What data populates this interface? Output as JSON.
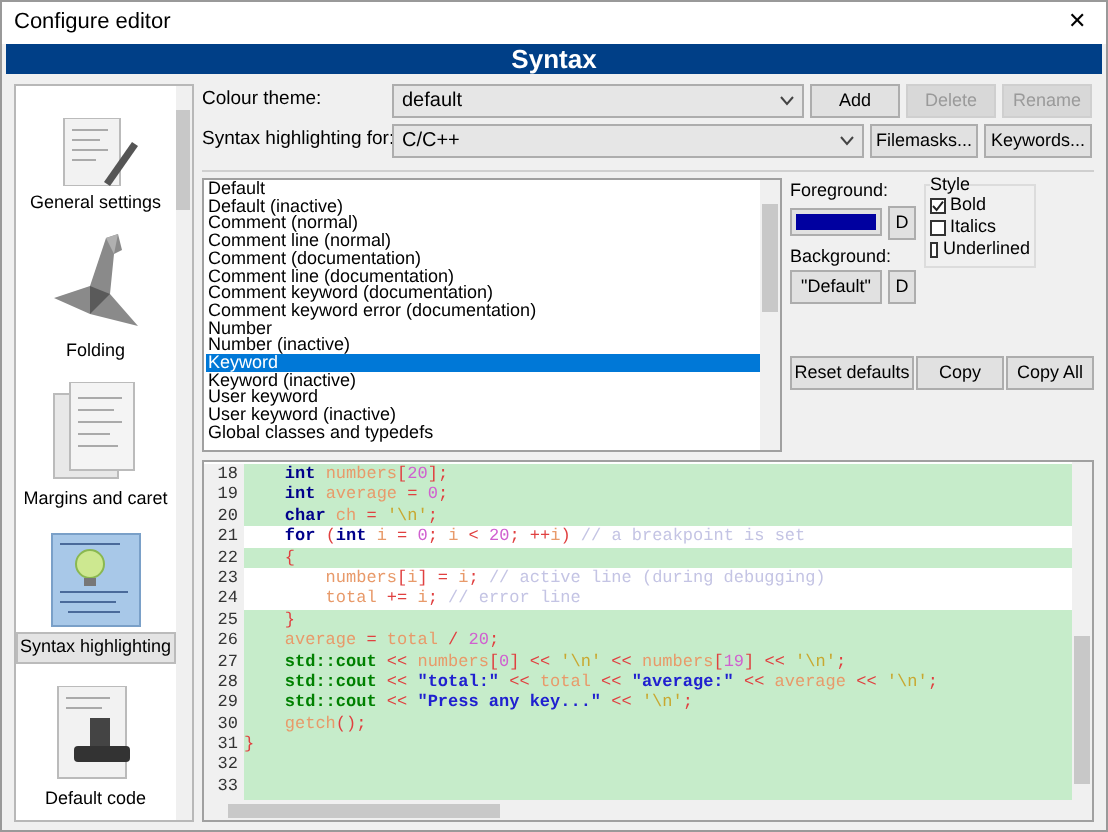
{
  "window": {
    "title": "Configure editor",
    "close": "✕"
  },
  "header": "Syntax",
  "sidebar": {
    "items": [
      {
        "label": "General settings",
        "selected": false
      },
      {
        "label": "Folding",
        "selected": false
      },
      {
        "label": "Margins and caret",
        "selected": false
      },
      {
        "label": "Syntax highlighting",
        "selected": true
      },
      {
        "label": "Default code",
        "selected": false
      }
    ]
  },
  "theme": {
    "label": "Colour theme:",
    "value": "default",
    "buttons": [
      {
        "label": "Add",
        "disabled": false
      },
      {
        "label": "Delete",
        "disabled": true
      },
      {
        "label": "Rename",
        "disabled": true
      }
    ]
  },
  "language": {
    "label": "Syntax highlighting for:",
    "value": "C/C++",
    "buttons": [
      {
        "label": "Filemasks...",
        "disabled": false
      },
      {
        "label": "Keywords...",
        "disabled": false
      }
    ]
  },
  "styles": [
    {
      "label": "Default",
      "selected": false
    },
    {
      "label": "Default (inactive)",
      "selected": false
    },
    {
      "label": "Comment (normal)",
      "selected": false
    },
    {
      "label": "Comment line (normal)",
      "selected": false
    },
    {
      "label": "Comment (documentation)",
      "selected": false
    },
    {
      "label": "Comment line (documentation)",
      "selected": false
    },
    {
      "label": "Comment keyword (documentation)",
      "selected": false
    },
    {
      "label": "Comment keyword error (documentation)",
      "selected": false
    },
    {
      "label": "Number",
      "selected": false
    },
    {
      "label": "Number (inactive)",
      "selected": false
    },
    {
      "label": "Keyword",
      "selected": true
    },
    {
      "label": "Keyword (inactive)",
      "selected": false
    },
    {
      "label": "User keyword",
      "selected": false
    },
    {
      "label": "User keyword (inactive)",
      "selected": false
    },
    {
      "label": "Global classes and typedefs",
      "selected": false
    }
  ],
  "foreground": {
    "label": "Foreground:",
    "color": "#0000a0",
    "reset": "D"
  },
  "background": {
    "label": "Background:",
    "value": "\"Default\"",
    "reset": "D"
  },
  "style_group": {
    "title": "Style",
    "options": [
      {
        "label": "Bold",
        "checked": true
      },
      {
        "label": "Italics",
        "checked": false
      },
      {
        "label": "Underlined",
        "checked": false
      }
    ]
  },
  "actions": [
    "Reset defaults",
    "Copy",
    "Copy All"
  ],
  "code": [
    {
      "n": "18",
      "marked": false,
      "tokens": [
        {
          "t": "    int",
          "kind": "keyword"
        },
        {
          "t": " numbers",
          "kind": "identifier"
        },
        {
          "t": "[",
          "kind": "operator"
        },
        {
          "t": "20",
          "kind": "number"
        },
        {
          "t": "];",
          "kind": "operator"
        }
      ]
    },
    {
      "n": "19",
      "marked": false,
      "tokens": [
        {
          "t": "    int",
          "kind": "keyword"
        },
        {
          "t": " average",
          "kind": "identifier"
        },
        {
          "t": " = ",
          "kind": "operator"
        },
        {
          "t": "0",
          "kind": "number"
        },
        {
          "t": ";",
          "kind": "operator"
        }
      ]
    },
    {
      "n": "20",
      "marked": false,
      "tokens": [
        {
          "t": "    char",
          "kind": "keyword"
        },
        {
          "t": " ch",
          "kind": "identifier"
        },
        {
          "t": " = ",
          "kind": "operator"
        },
        {
          "t": "'\\n'",
          "kind": "char"
        },
        {
          "t": ";",
          "kind": "operator"
        }
      ]
    },
    {
      "n": "21",
      "marked": true,
      "tokens": [
        {
          "t": "    for",
          "kind": "keyword"
        },
        {
          "t": " (",
          "kind": "operator"
        },
        {
          "t": "int",
          "kind": "keyword"
        },
        {
          "t": " i",
          "kind": "identifier"
        },
        {
          "t": " = ",
          "kind": "operator"
        },
        {
          "t": "0",
          "kind": "number"
        },
        {
          "t": "; ",
          "kind": "operator"
        },
        {
          "t": "i",
          "kind": "identifier"
        },
        {
          "t": " < ",
          "kind": "operator"
        },
        {
          "t": "20",
          "kind": "number"
        },
        {
          "t": "; ++",
          "kind": "operator"
        },
        {
          "t": "i",
          "kind": "identifier"
        },
        {
          "t": ")",
          "kind": "operator"
        },
        {
          "t": " // a breakpoint is set",
          "kind": "comment"
        }
      ]
    },
    {
      "n": "22",
      "marked": false,
      "tokens": [
        {
          "t": "    {",
          "kind": "operator"
        }
      ]
    },
    {
      "n": "23",
      "marked": true,
      "tokens": [
        {
          "t": "        numbers",
          "kind": "identifier"
        },
        {
          "t": "[",
          "kind": "operator"
        },
        {
          "t": "i",
          "kind": "identifier"
        },
        {
          "t": "] = ",
          "kind": "operator"
        },
        {
          "t": "i",
          "kind": "identifier"
        },
        {
          "t": ";",
          "kind": "operator"
        },
        {
          "t": " // active line (during debugging)",
          "kind": "comment"
        }
      ]
    },
    {
      "n": "24",
      "marked": true,
      "tokens": [
        {
          "t": "        total",
          "kind": "identifier"
        },
        {
          "t": " += ",
          "kind": "operator"
        },
        {
          "t": "i",
          "kind": "identifier"
        },
        {
          "t": ";",
          "kind": "operator"
        },
        {
          "t": " // error line",
          "kind": "comment"
        }
      ]
    },
    {
      "n": "25",
      "marked": false,
      "tokens": [
        {
          "t": "    }",
          "kind": "operator"
        }
      ]
    },
    {
      "n": "26",
      "marked": false,
      "tokens": [
        {
          "t": "    average",
          "kind": "identifier"
        },
        {
          "t": " = ",
          "kind": "operator"
        },
        {
          "t": "total",
          "kind": "identifier"
        },
        {
          "t": " / ",
          "kind": "operator"
        },
        {
          "t": "20",
          "kind": "number"
        },
        {
          "t": ";",
          "kind": "operator"
        }
      ]
    },
    {
      "n": "27",
      "marked": false,
      "tokens": [
        {
          "t": "    std::cout",
          "kind": "std"
        },
        {
          "t": " << ",
          "kind": "operator"
        },
        {
          "t": "numbers",
          "kind": "identifier"
        },
        {
          "t": "[",
          "kind": "operator"
        },
        {
          "t": "0",
          "kind": "number"
        },
        {
          "t": "] << ",
          "kind": "operator"
        },
        {
          "t": "'\\n'",
          "kind": "char"
        },
        {
          "t": " << ",
          "kind": "operator"
        },
        {
          "t": "numbers",
          "kind": "identifier"
        },
        {
          "t": "[",
          "kind": "operator"
        },
        {
          "t": "19",
          "kind": "number"
        },
        {
          "t": "] << ",
          "kind": "operator"
        },
        {
          "t": "'\\n'",
          "kind": "char"
        },
        {
          "t": ";",
          "kind": "operator"
        }
      ]
    },
    {
      "n": "28",
      "marked": false,
      "tokens": [
        {
          "t": "    std::cout",
          "kind": "std"
        },
        {
          "t": " << ",
          "kind": "operator"
        },
        {
          "t": "\"total:\"",
          "kind": "string"
        },
        {
          "t": " << ",
          "kind": "operator"
        },
        {
          "t": "total",
          "kind": "identifier"
        },
        {
          "t": " << ",
          "kind": "operator"
        },
        {
          "t": "\"average:\"",
          "kind": "string"
        },
        {
          "t": " << ",
          "kind": "operator"
        },
        {
          "t": "average",
          "kind": "identifier"
        },
        {
          "t": " << ",
          "kind": "operator"
        },
        {
          "t": "'\\n'",
          "kind": "char"
        },
        {
          "t": ";",
          "kind": "operator"
        }
      ]
    },
    {
      "n": "29",
      "marked": false,
      "tokens": [
        {
          "t": "    std::cout",
          "kind": "std"
        },
        {
          "t": " << ",
          "kind": "operator"
        },
        {
          "t": "\"Press any key...\"",
          "kind": "string"
        },
        {
          "t": " << ",
          "kind": "operator"
        },
        {
          "t": "'\\n'",
          "kind": "char"
        },
        {
          "t": ";",
          "kind": "operator"
        }
      ]
    },
    {
      "n": "30",
      "marked": false,
      "tokens": [
        {
          "t": "    getch",
          "kind": "identifier"
        },
        {
          "t": "();",
          "kind": "operator"
        }
      ]
    },
    {
      "n": "31",
      "marked": false,
      "tokens": [
        {
          "t": "}",
          "kind": "operator"
        }
      ]
    },
    {
      "n": "32",
      "marked": false
    },
    {
      "n": "33",
      "marked": false
    }
  ]
}
